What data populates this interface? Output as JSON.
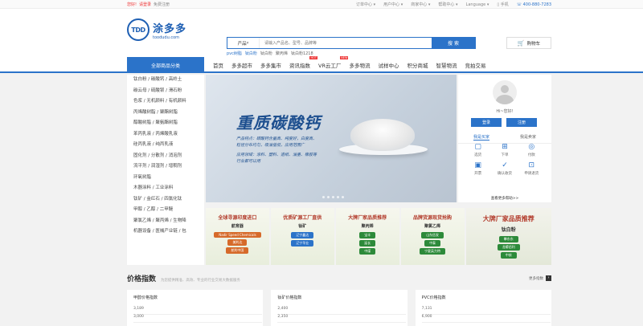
{
  "topbar": {
    "greeting": "您好!",
    "login": "请登录",
    "register": "免费注册",
    "menus": [
      "订单中心",
      "用户中心",
      "商家中心",
      "帮助中心",
      "Language"
    ],
    "mobile": "手机",
    "phone": "400-880-7283"
  },
  "logo": {
    "badge": "TDD",
    "name": "涂多多",
    "domain": "toodudu.com"
  },
  "search": {
    "category": "产品",
    "placeholder": "请输入产品名、型号、品牌等",
    "button": "搜 索",
    "hot": [
      "pvc树脂",
      "钛白粉",
      "钛白粉",
      "聚丙烯",
      "钛白粉1218"
    ]
  },
  "cart": {
    "label": "购物车"
  },
  "nav": {
    "all": "全部商品分类",
    "items": [
      "首页",
      "多多超市",
      "多多集市",
      "资讯指数",
      "VR云工厂",
      "多多物流",
      "试样中心",
      "积分商城",
      "智慧物流",
      "竞拍交易"
    ]
  },
  "sidebar": {
    "items": [
      "钛白粉 / 碳酸钙 / 高岭土",
      "碳云母 / 硫酸钡 / 滑石粉",
      "色浆 / 无机颜料 / 有机颜料",
      "丙烯酸树脂 / 聚酯树脂",
      "醇酸树脂 / 聚氨酯树脂",
      "苯丙乳液 / 丙烯酸乳液",
      "硅丙乳液 / 纯丙乳液",
      "固化剂 / 分散剂 / 消泡剂",
      "流平剂 / 润湿剂 / 增稠剂",
      "环氧树脂",
      "木器涂料 / 工业涂料",
      "钛矿 / 金红石 / 四氯化钛",
      "甲醇 / 乙醇 / 二甲醚",
      "聚氯乙烯 / 聚丙烯 / 生物降",
      "机器设备 / 医械产业链 / 包"
    ]
  },
  "banner": {
    "title": "重质碳酸钙",
    "lines": [
      "产品特点：碳酸钙含量高、纯度好，白度高、",
      "粒径分布均匀，吸油值低，应用范围广",
      "应用领域：涂料、塑料、造纸、油墨、橡胶等",
      "行业都可以用"
    ]
  },
  "user": {
    "hi": "Hi~您好!",
    "login_btn": "登录",
    "register_btn": "注册",
    "tabs": [
      "我是买家",
      "我是卖家"
    ],
    "grid": [
      {
        "icon": "clipboard-icon",
        "glyph": "▢",
        "label": "选货"
      },
      {
        "icon": "cart-icon",
        "glyph": "⊞",
        "label": "下单"
      },
      {
        "icon": "wallet-icon",
        "glyph": "◎",
        "label": "付款"
      },
      {
        "icon": "box-icon",
        "glyph": "▣",
        "label": "开票"
      },
      {
        "icon": "check-icon",
        "glyph": "✓",
        "label": "确认收货"
      },
      {
        "icon": "truck-icon",
        "glyph": "⊡",
        "label": "申请退货"
      }
    ],
    "more": "查看更多帮助>>"
  },
  "promo": [
    {
      "title": "全球寻源印度进口",
      "sub": "航育器",
      "pills": [
        "Nadir Speed Chemicals",
        "美利达",
        "航利中国"
      ],
      "pillcolors": [
        "o",
        "o",
        "o"
      ]
    },
    {
      "title": "优质矿源工厂直供",
      "sub": "钛矿",
      "pills": [
        "辽宁鑫达",
        "辽宁华业"
      ],
      "pillcolors": [
        "b",
        "b"
      ]
    },
    {
      "title": "大牌厂家品质推荐",
      "sub": "聚丙烯",
      "pills": [
        "宝丰",
        "延长",
        "中煤"
      ],
      "pillcolors": [
        "",
        "",
        ""
      ]
    },
    {
      "title": "品牌货源现货抢购",
      "sub": "聚氯乙烯",
      "pills": [
        "山东信发",
        "中泰",
        "宁夏英力特"
      ],
      "pillcolors": [
        "",
        "",
        ""
      ]
    },
    {
      "title": "大牌厂家品质推荐",
      "sub": "钛白粉",
      "pills": [
        "攀东东",
        "龙蟒佰利",
        "中核"
      ],
      "pillcolors": [
        "",
        "",
        ""
      ]
    }
  ],
  "section": {
    "title": "价格指数",
    "desc": "为您提供精准、高效、专业的行业交易大数据服务",
    "more": "更多指数"
  },
  "panels": [
    {
      "title": "甲醇价格指数",
      "ticks": [
        "3,189",
        "3,000"
      ]
    },
    {
      "title": "钛矿价格指数",
      "ticks": [
        "2,400",
        "2,350"
      ]
    },
    {
      "title": "PVC价格指数",
      "ticks": [
        "7,131",
        "6,900"
      ]
    }
  ]
}
